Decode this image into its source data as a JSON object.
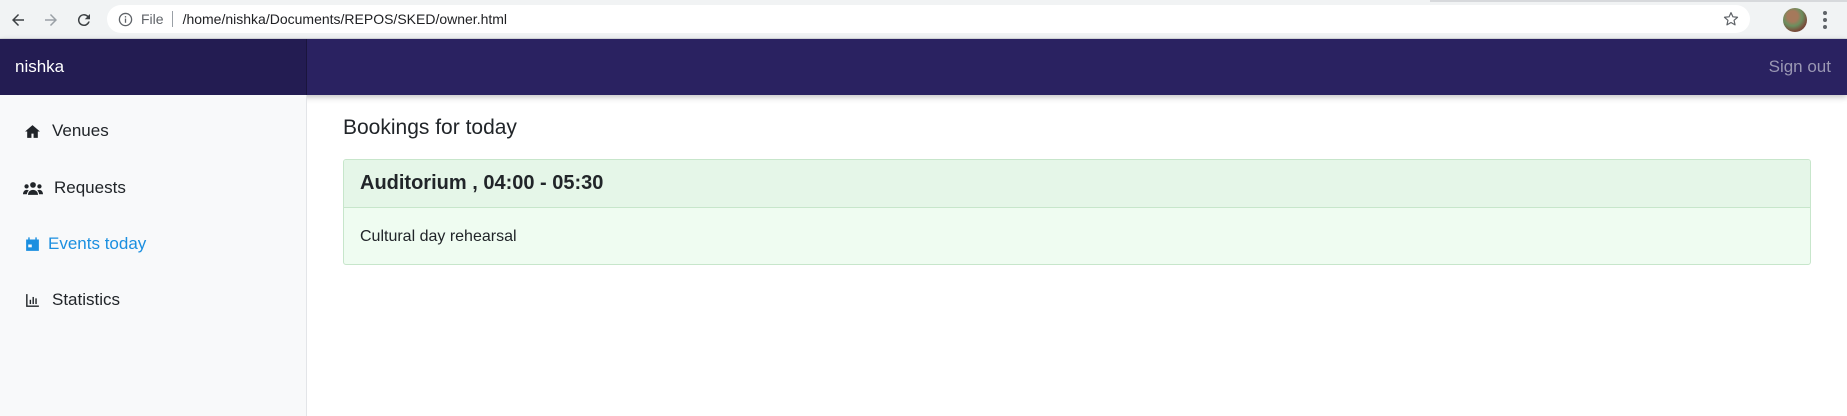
{
  "browser": {
    "scheme_label": "File",
    "url": "/home/nishka/Documents/REPOS/SKED/owner.html"
  },
  "navbar": {
    "brand": "nishka",
    "signout": "Sign out"
  },
  "sidebar": {
    "items": [
      {
        "label": "Venues",
        "icon": "home-icon"
      },
      {
        "label": "Requests",
        "icon": "users-icon"
      },
      {
        "label": "Events today",
        "icon": "calendar-icon",
        "active": true
      },
      {
        "label": "Statistics",
        "icon": "bar-chart-icon"
      }
    ]
  },
  "main": {
    "title": "Bookings for today",
    "bookings": [
      {
        "header": "Auditorium , 04:00 - 05:30",
        "description": "Cultural day rehearsal"
      }
    ]
  },
  "colors": {
    "navbar": "#2a2261",
    "brand_bg": "#231c52",
    "active_link": "#1b8fe0",
    "card_bg": "#effcf1",
    "card_header_bg": "#e5f6e8",
    "card_border": "#c7e6cb"
  }
}
